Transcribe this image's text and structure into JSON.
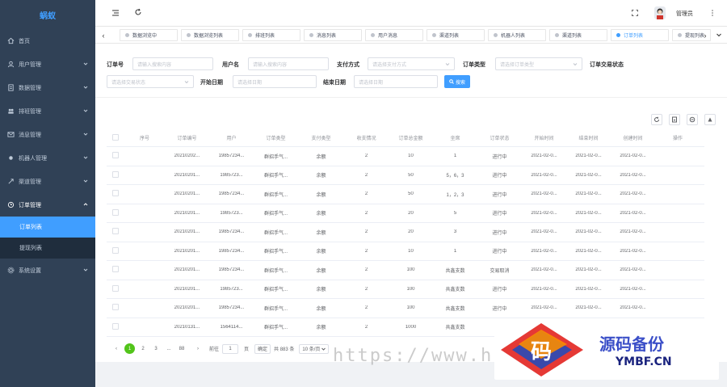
{
  "sidebar": {
    "logo": "蜗蚁",
    "items": [
      {
        "label": "首页",
        "icon": "home-icon"
      },
      {
        "label": "用户管理",
        "icon": "user-icon"
      },
      {
        "label": "数据管理",
        "icon": "doc-icon"
      },
      {
        "label": "排班管理",
        "icon": "team-icon"
      },
      {
        "label": "消息管理",
        "icon": "message-icon"
      },
      {
        "label": "机器人管理",
        "icon": "robot-icon"
      },
      {
        "label": "渠道管理",
        "icon": "channel-icon"
      },
      {
        "label": "订单管理",
        "icon": "order-icon"
      },
      {
        "label": "系统设置",
        "icon": "gear-icon"
      }
    ],
    "submenu": [
      {
        "label": "订单列表"
      },
      {
        "label": "提现列表"
      }
    ]
  },
  "header": {
    "username": "管理员"
  },
  "tags": [
    {
      "label": "数据浏览中"
    },
    {
      "label": "数据浏览列表"
    },
    {
      "label": "排班列表"
    },
    {
      "label": "消息列表"
    },
    {
      "label": "用户消息"
    },
    {
      "label": "渠道列表"
    },
    {
      "label": "机器人列表"
    },
    {
      "label": "渠道列表"
    },
    {
      "label": "订单列表"
    },
    {
      "label": "提现列表"
    }
  ],
  "filters": {
    "order_no_label": "订单号",
    "order_no_placeholder": "请输入搜索内容",
    "user_label": "用户名",
    "user_placeholder": "请输入搜索内容",
    "pay_label": "支付方式",
    "pay_placeholder": "请选择支付方式",
    "type_label": "订单类型",
    "type_placeholder": "请选择订单类型",
    "status_label": "订单交易状态",
    "status_placeholder": "请选择交易状态",
    "start_label": "开始日期",
    "start_placeholder": "请选择日期",
    "end_label": "结束日期",
    "end_placeholder": "请选择日期",
    "search_button": "搜索"
  },
  "table": {
    "columns": [
      "序号",
      "订单编号",
      "用户",
      "订单类型",
      "支付类型",
      "收支情况",
      "订单总金额",
      "坐席",
      "订单状态",
      "开始时间",
      "结束时间",
      "创建时间",
      "操作"
    ],
    "rows": [
      [
        "",
        "20210202...",
        "19857234...",
        "群招手气...",
        "余额",
        "2",
        "10",
        "1",
        "进行中",
        "2021-02-0...",
        "2021-02-0...",
        "2021-02-0...",
        ""
      ],
      [
        "",
        "20210201...",
        "1985723...",
        "群招手气...",
        "余额",
        "2",
        "50",
        "5，6，3",
        "进行中",
        "2021-02-0...",
        "2021-02-0...",
        "2021-02-0...",
        ""
      ],
      [
        "",
        "20210201...",
        "19857234...",
        "群招手气...",
        "余额",
        "2",
        "50",
        "1，2，3",
        "进行中",
        "2021-02-0...",
        "2021-02-0...",
        "2021-02-0...",
        ""
      ],
      [
        "",
        "20210201...",
        "1985723...",
        "群招手气...",
        "余额",
        "2",
        "20",
        "5",
        "进行中",
        "2021-02-0...",
        "2021-02-0...",
        "2021-02-0...",
        ""
      ],
      [
        "",
        "20210201...",
        "19857234...",
        "群招手气...",
        "余额",
        "2",
        "20",
        "3",
        "进行中",
        "2021-02-0...",
        "2021-02-0...",
        "2021-02-0...",
        ""
      ],
      [
        "",
        "20210201...",
        "19857234...",
        "群招手气...",
        "余额",
        "2",
        "10",
        "1",
        "进行中",
        "2021-02-0...",
        "2021-02-0...",
        "2021-02-0...",
        ""
      ],
      [
        "",
        "20210201...",
        "19857234...",
        "群招手气...",
        "余额",
        "2",
        "100",
        "共鑫支数",
        "交易取消",
        "2021-02-0...",
        "2021-02-0...",
        "2021-02-0...",
        ""
      ],
      [
        "",
        "20210201...",
        "1985723...",
        "群招手气...",
        "余额",
        "2",
        "100",
        "共鑫支数",
        "进行中",
        "2021-02-0...",
        "2021-02-0...",
        "2021-02-0...",
        ""
      ],
      [
        "",
        "20210201...",
        "19857234...",
        "群招手气...",
        "余额",
        "2",
        "100",
        "共鑫支数",
        "进行中",
        "2021-02-0...",
        "2021-02-0...",
        "2021-02-0...",
        ""
      ],
      [
        "",
        "20210131...",
        "1564114...",
        "群招手气...",
        "余额",
        "2",
        "1000",
        "共鑫支数",
        "",
        "",
        "",
        "",
        ""
      ]
    ]
  },
  "pager": {
    "pages": [
      "1",
      "2",
      "3",
      "...",
      "88"
    ],
    "goto_label": "前往",
    "goto_value": "1",
    "page_unit": "页",
    "confirm": "确定",
    "total": "共 883 条",
    "page_size": "10 条/页"
  },
  "watermark": {
    "url": "https://www.hu",
    "badge_glyph": "码",
    "title": "源码备份",
    "subtitle": "YMBF.CN"
  },
  "colors": {
    "sidebar_bg": "#304156",
    "accent": "#409eff",
    "active_page": "#52c41a"
  }
}
